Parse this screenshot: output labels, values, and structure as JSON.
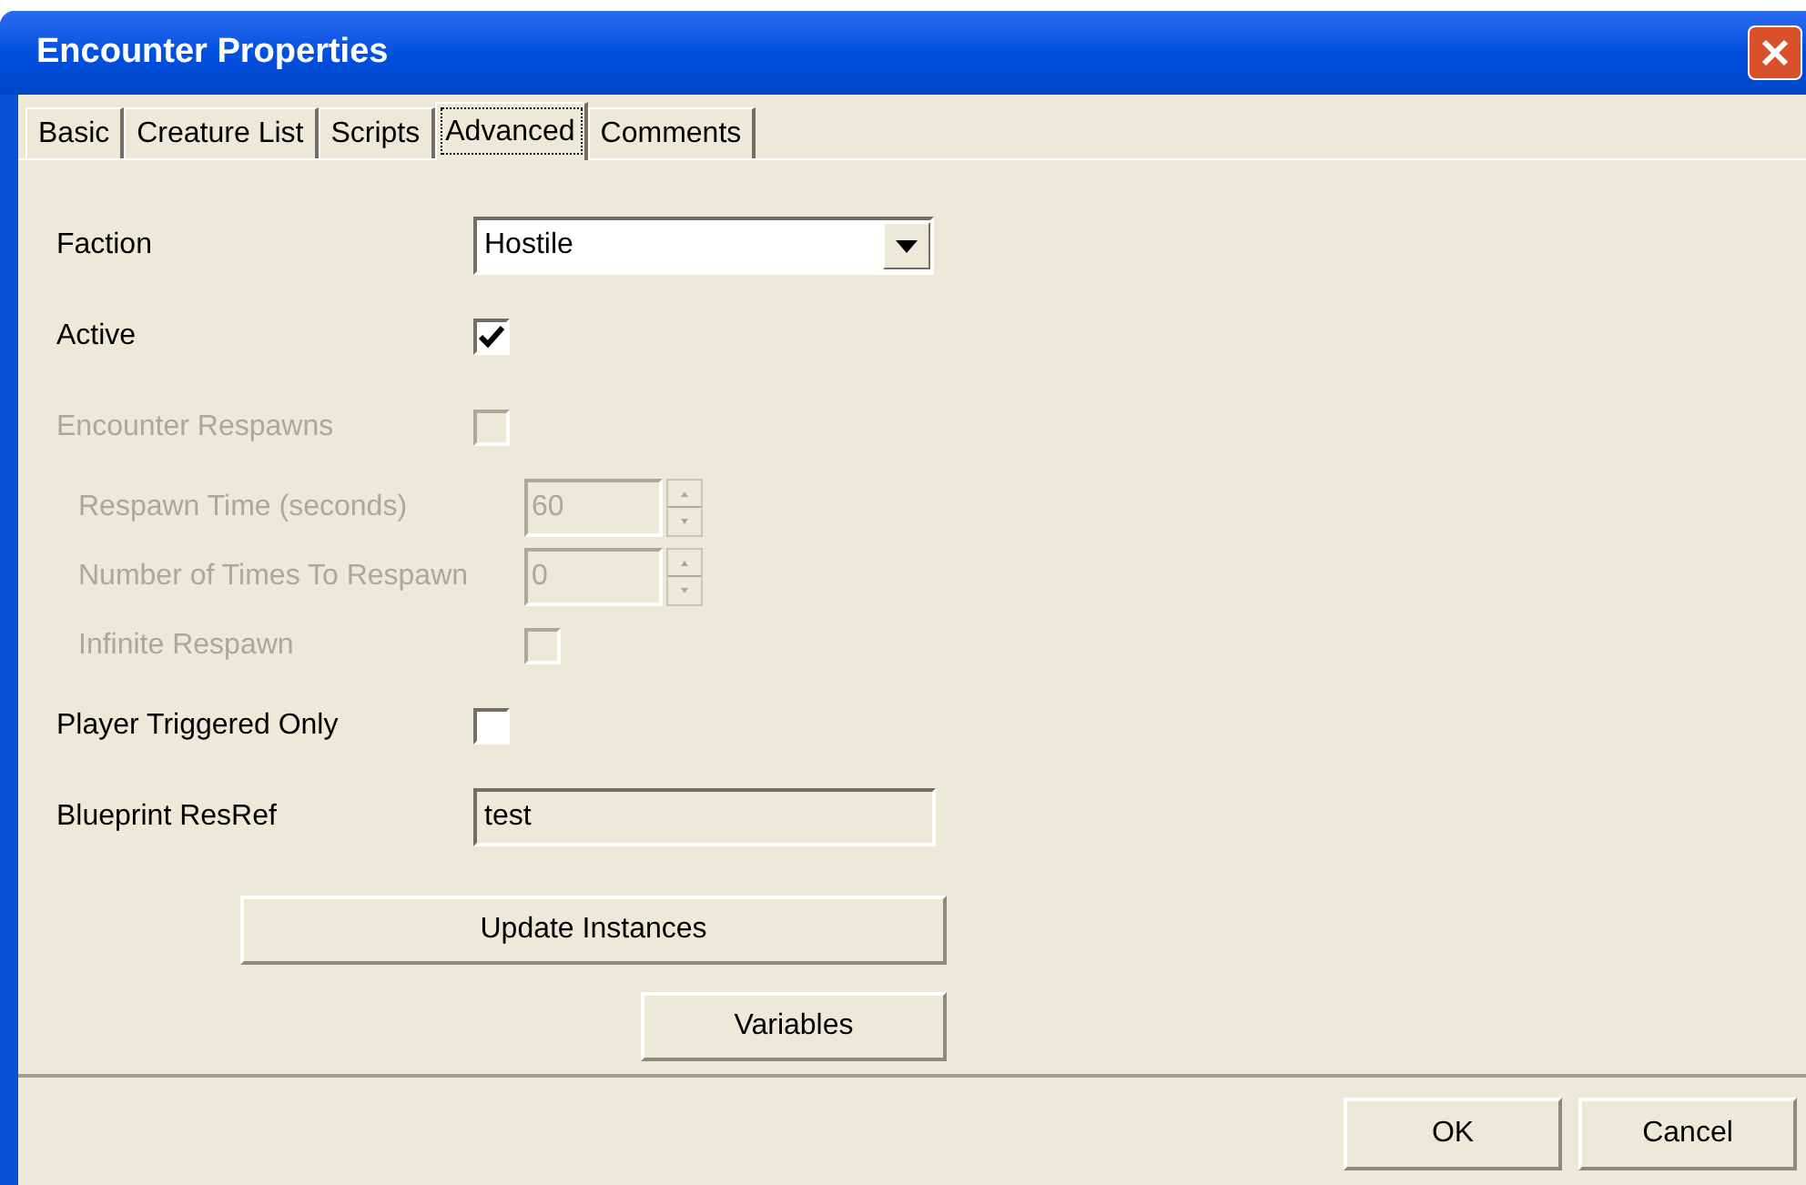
{
  "window": {
    "title": "Encounter Properties"
  },
  "tabs": [
    {
      "label": "Basic",
      "selected": false
    },
    {
      "label": "Creature List",
      "selected": false
    },
    {
      "label": "Scripts",
      "selected": false
    },
    {
      "label": "Advanced",
      "selected": true
    },
    {
      "label": "Comments",
      "selected": false
    }
  ],
  "fields": [
    {
      "kind": "dropdown",
      "label": "Faction",
      "value": "Hostile",
      "disabled": false
    },
    {
      "kind": "checkbox",
      "label": "Active",
      "checked": true,
      "disabled": false
    },
    {
      "kind": "checkbox",
      "label": "Encounter Respawns",
      "checked": false,
      "disabled": true,
      "children": [
        {
          "kind": "spin",
          "label": "Respawn Time (seconds)",
          "value": "60",
          "disabled": true
        },
        {
          "kind": "spin",
          "label": "Number of Times To Respawn",
          "value": "0",
          "disabled": true
        },
        {
          "kind": "checkbox",
          "label": "Infinite Respawn",
          "checked": false,
          "disabled": true
        }
      ]
    },
    {
      "kind": "checkbox",
      "label": "Player Triggered Only",
      "checked": false,
      "disabled": false
    },
    {
      "kind": "text",
      "label": "Blueprint ResRef",
      "value": "test",
      "disabled": false
    }
  ],
  "actions": [
    "Update Instances",
    "Variables"
  ],
  "buttons": [
    "OK",
    "Cancel"
  ]
}
